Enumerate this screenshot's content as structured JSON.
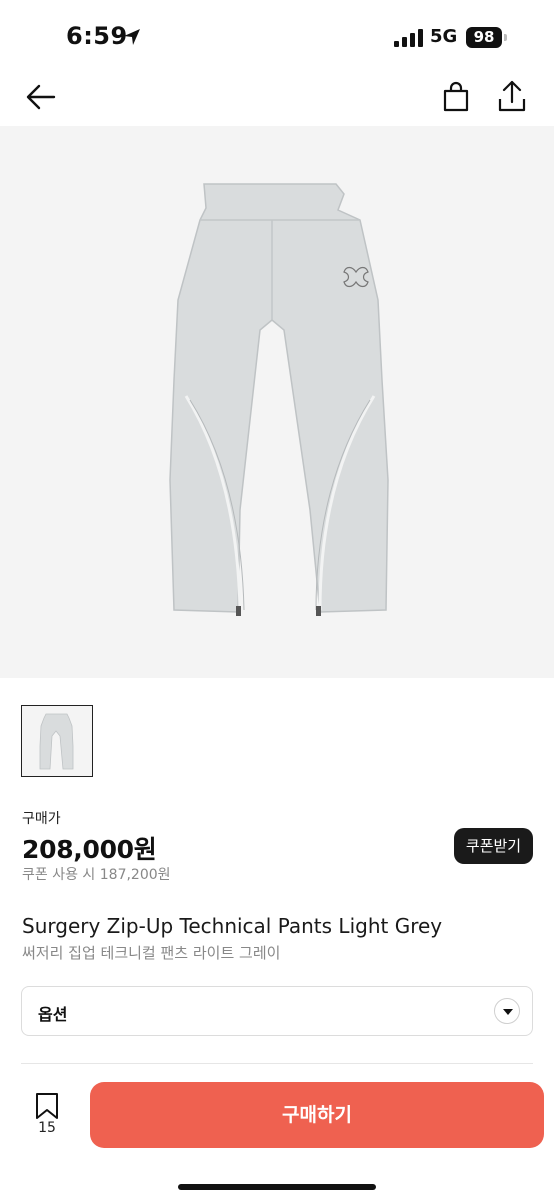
{
  "status": {
    "time": "6:59",
    "network": "5G",
    "battery": "98"
  },
  "nav": {
    "back_icon": "arrow-left-icon",
    "bag_icon": "shopping-bag-icon",
    "share_icon": "share-icon"
  },
  "product": {
    "price_label": "구매가",
    "price": "208,000원",
    "coupon_price": "쿠폰 사용 시 187,200원",
    "coupon_button": "쿠폰받기",
    "name": "Surgery Zip-Up Technical Pants Light Grey",
    "name_kr": "써저리 집업 테크니컬 팬츠 라이트 그레이"
  },
  "option": {
    "label": "옵션",
    "icon": "chevron-down-icon"
  },
  "bottom": {
    "bookmark_count": "15",
    "buy_label": "구매하기"
  },
  "colors": {
    "accent": "#ef6150",
    "pants": "#d9dcdd"
  }
}
